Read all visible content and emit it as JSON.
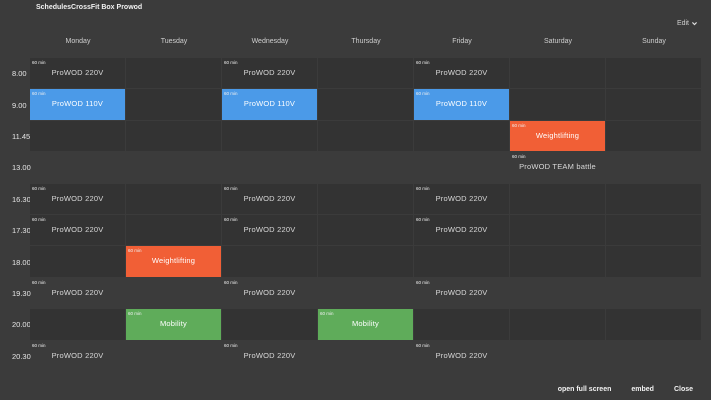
{
  "header": {
    "title": "SchedulesCrossFit Box Prowod",
    "edit_label": "Edit"
  },
  "days": [
    "Monday",
    "Tuesday",
    "Wednesday",
    "Thursday",
    "Friday",
    "Saturday",
    "Sunday"
  ],
  "colors": {
    "blue": "#4b9ae8",
    "orange": "#f15f36",
    "green": "#5fac5a"
  },
  "rows": [
    {
      "time": "8.00",
      "events": [
        {
          "day": 0,
          "duration": "60 min",
          "name": "ProWOD 220V",
          "color": ""
        },
        {
          "day": 2,
          "duration": "60 min",
          "name": "ProWOD 220V",
          "color": ""
        },
        {
          "day": 4,
          "duration": "60 min",
          "name": "ProWOD 220V",
          "color": ""
        }
      ]
    },
    {
      "time": "9.00",
      "events": [
        {
          "day": 0,
          "duration": "60 min",
          "name": "ProWOD 110V",
          "color": "blue"
        },
        {
          "day": 2,
          "duration": "60 min",
          "name": "ProWOD 110V",
          "color": "blue"
        },
        {
          "day": 4,
          "duration": "60 min",
          "name": "ProWOD 110V",
          "color": "blue"
        }
      ]
    },
    {
      "time": "11.45",
      "events": [
        {
          "day": 5,
          "duration": "60 min",
          "name": "Weightlifting",
          "color": "orange"
        }
      ]
    },
    {
      "time": "13.00",
      "blank": true,
      "events": [
        {
          "day": 5,
          "duration": "60 min",
          "name": "ProWOD TEAM battle",
          "color": ""
        }
      ]
    },
    {
      "time": "16.30",
      "events": [
        {
          "day": 0,
          "duration": "60 min",
          "name": "ProWOD 220V",
          "color": ""
        },
        {
          "day": 2,
          "duration": "60 min",
          "name": "ProWOD 220V",
          "color": ""
        },
        {
          "day": 4,
          "duration": "60 min",
          "name": "ProWOD 220V",
          "color": ""
        }
      ]
    },
    {
      "time": "17.30",
      "events": [
        {
          "day": 0,
          "duration": "60 min",
          "name": "ProWOD 220V",
          "color": ""
        },
        {
          "day": 2,
          "duration": "60 min",
          "name": "ProWOD 220V",
          "color": ""
        },
        {
          "day": 4,
          "duration": "60 min",
          "name": "ProWOD 220V",
          "color": ""
        }
      ]
    },
    {
      "time": "18.00",
      "events": [
        {
          "day": 1,
          "duration": "60 min",
          "name": "Weightlifting",
          "color": "orange"
        }
      ]
    },
    {
      "time": "19.30",
      "blank": true,
      "events": [
        {
          "day": 0,
          "duration": "60 min",
          "name": "ProWOD 220V",
          "color": ""
        },
        {
          "day": 2,
          "duration": "60 min",
          "name": "ProWOD 220V",
          "color": ""
        },
        {
          "day": 4,
          "duration": "60 min",
          "name": "ProWOD 220V",
          "color": ""
        }
      ]
    },
    {
      "time": "20.00",
      "events": [
        {
          "day": 1,
          "duration": "60 min",
          "name": "Mobility",
          "color": "green"
        },
        {
          "day": 3,
          "duration": "60 min",
          "name": "Mobility",
          "color": "green"
        }
      ]
    },
    {
      "time": "20.30",
      "blank": true,
      "events": [
        {
          "day": 0,
          "duration": "60 min",
          "name": "ProWOD 220V",
          "color": ""
        },
        {
          "day": 2,
          "duration": "60 min",
          "name": "ProWOD 220V",
          "color": ""
        },
        {
          "day": 4,
          "duration": "60 min",
          "name": "ProWOD 220V",
          "color": ""
        }
      ]
    }
  ],
  "footer": {
    "fullscreen_label": "open full screen",
    "embed_label": "embed",
    "close_label": "Close"
  }
}
